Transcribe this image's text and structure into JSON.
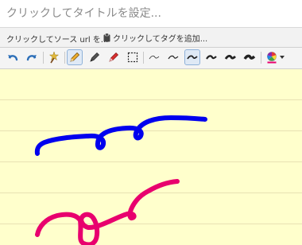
{
  "title": {
    "placeholder": "クリックしてタイトルを設定..."
  },
  "meta": {
    "source_label": "クリックしてソース url を...",
    "tags_label": "クリックしてタグを追加..."
  },
  "toolbar": {
    "tools": [
      {
        "icon": "undo-icon"
      },
      {
        "icon": "redo-icon"
      },
      {
        "icon": "magic-wand-icon"
      },
      {
        "icon": "pencil-icon",
        "active": true
      },
      {
        "icon": "pen-icon"
      },
      {
        "icon": "marker-icon"
      },
      {
        "icon": "selection-rectangle-icon"
      },
      {
        "icon": "stroke-width-1-icon"
      },
      {
        "icon": "stroke-width-2-icon"
      },
      {
        "icon": "stroke-width-3-icon",
        "active": true
      },
      {
        "icon": "stroke-width-4-icon"
      },
      {
        "icon": "stroke-width-5-icon"
      },
      {
        "icon": "stroke-width-6-icon"
      },
      {
        "icon": "color-picker-icon"
      }
    ]
  },
  "colors": {
    "accent_active": "#8fb2d9",
    "paper": "#ffffcc",
    "stroke_blue": "#0000ee",
    "stroke_pink": "#e8006e"
  },
  "strokes": [
    {
      "color": "#0000ee"
    },
    {
      "color": "#e8006e"
    }
  ]
}
